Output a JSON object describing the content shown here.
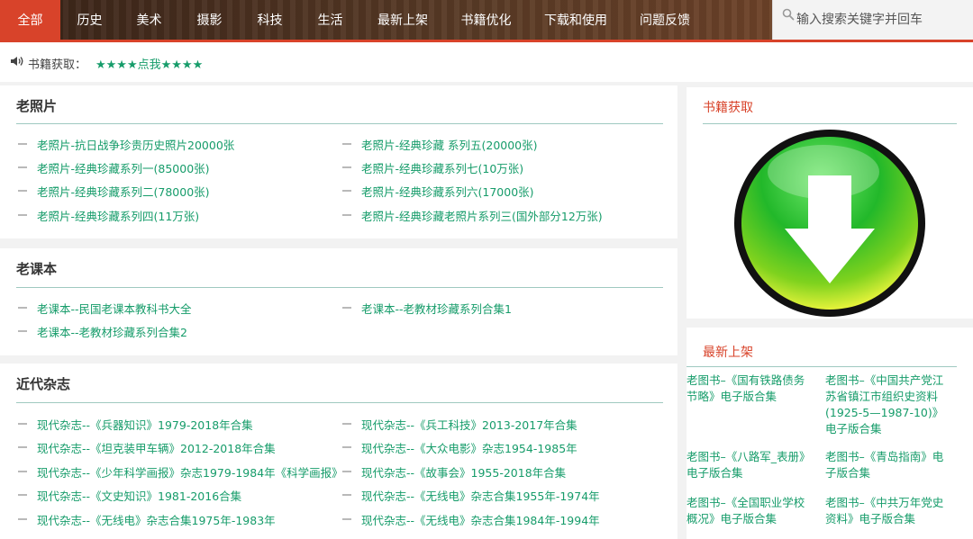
{
  "nav": {
    "items": [
      "全部",
      "历史",
      "美术",
      "摄影",
      "科技",
      "生活",
      "最新上架",
      "书籍优化",
      "下载和使用",
      "问题反馈"
    ],
    "search_placeholder": "输入搜索关键字并回车"
  },
  "notice": {
    "label": "书籍获取：",
    "link": "★★★★点我★★★★"
  },
  "sections": [
    {
      "title": "老照片",
      "links": [
        "老照片-抗日战争珍贵历史照片20000张",
        "老照片-经典珍藏 系列五(20000张)",
        "老照片-经典珍藏系列一(85000张)",
        "老照片-经典珍藏系列七(10万张)",
        "老照片-经典珍藏系列二(78000张)",
        "老照片-经典珍藏系列六(17000张)",
        "老照片-经典珍藏系列四(11万张)",
        "老照片-经典珍藏老照片系列三(国外部分12万张)"
      ]
    },
    {
      "title": "老课本",
      "links": [
        "老课本--民国老课本教科书大全",
        "老课本--老教材珍藏系列合集1",
        "老课本--老教材珍藏系列合集2"
      ]
    },
    {
      "title": "近代杂志",
      "links": [
        "现代杂志--《兵器知识》1979-2018年合集",
        "现代杂志--《兵工科技》2013-2017年合集",
        "现代杂志--《坦克装甲车辆》2012-2018年合集",
        "现代杂志--《大众电影》杂志1954-1985年",
        "现代杂志--《少年科学画报》杂志1979-1984年《科学画报》",
        "现代杂志--《故事会》1955-2018年合集",
        "现代杂志--《文史知识》1981-2016合集",
        "现代杂志--《无线电》杂志合集1955年-1974年",
        "现代杂志--《无线电》杂志合集1975年-1983年",
        "现代杂志--《无线电》杂志合集1984年-1994年"
      ]
    }
  ],
  "sidebar": {
    "download_title": "书籍获取",
    "new_title": "最新上架",
    "new_items": [
      "老图书–《国有铁路债务节略》电子版合集",
      "老图书–《中国共产党江苏省镇江市组织史资料(1925-5—1987-10)》电子版合集",
      "老图书–《八路军_表册》电子版合集",
      "老图书–《青岛指南》电子版合集",
      "老图书–《全国职业学校概况》电子版合集",
      "老图书–《中共万年党史资料》电子版合集"
    ]
  },
  "colors": {
    "accent": "#d8432a",
    "link": "#169c6a"
  }
}
